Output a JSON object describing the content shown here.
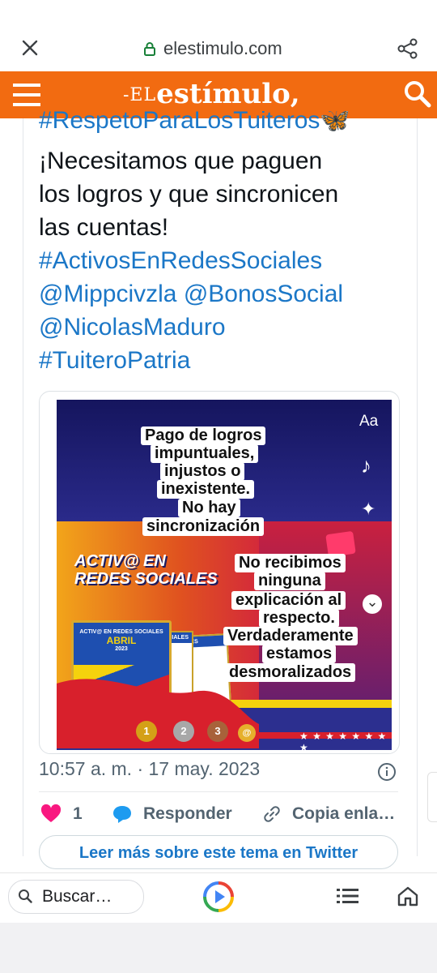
{
  "browser": {
    "url": "elestimulo.com",
    "icons": {
      "close": "close-icon",
      "lock": "lock-icon",
      "share": "share-icon"
    }
  },
  "site_header": {
    "logo_prefix": "-EL",
    "logo_name": "estímulo,",
    "brand_color": "#f26b11",
    "icons": {
      "menu": "hamburger-menu-icon",
      "search": "search-icon"
    }
  },
  "tweet": {
    "lines": [
      "#RespetoParaLosTuiteros🦋",
      "¡Necesitamos  que paguen",
      "los logros y que sincronicen",
      "las cuentas!",
      "#ActivosEnRedesSociales",
      "@Mippcivzla @BonosSocial",
      "@NicolasMaduro",
      "#TuiteroPatria"
    ],
    "media": {
      "banner_line1": "ACTIV@ EN",
      "banner_line2": "REDES SOCIALES",
      "card_title": "ACTIV@ EN REDES SOCIALES",
      "card_month": "ABRIL",
      "card_year": "2023",
      "card_back_label": "OCIALES",
      "overlay_top": [
        "Pago de logros",
        "impuntuales,",
        "injustos o",
        "inexistente.",
        "No hay",
        "sincronización"
      ],
      "overlay_bottom": [
        "No recibimos",
        "ninguna",
        "explicación al",
        "respecto.",
        "Verdaderamente",
        "estamos",
        "desmoralizados"
      ],
      "side_tools": {
        "text_tool": "Aa",
        "music": "♪",
        "effects": "✦",
        "expand": "⌄"
      },
      "stars": "★ ★ ★ ★ ★ ★ ★ ★",
      "medals": [
        "1",
        "2",
        "3",
        "@"
      ]
    },
    "timestamp": "10:57 a. m. · 17 may. 2023",
    "like_count": "1",
    "reply_label": "Responder",
    "copy_label": "Copia enla…",
    "read_more": "Leer más sobre este tema en Twitter",
    "link_color": "#1b77c7"
  },
  "bottom_bar": {
    "search_placeholder": "Buscar…",
    "icons": {
      "search": "search-icon",
      "discover": "google-play-circle-icon",
      "list": "list-icon",
      "home": "home-icon"
    }
  }
}
